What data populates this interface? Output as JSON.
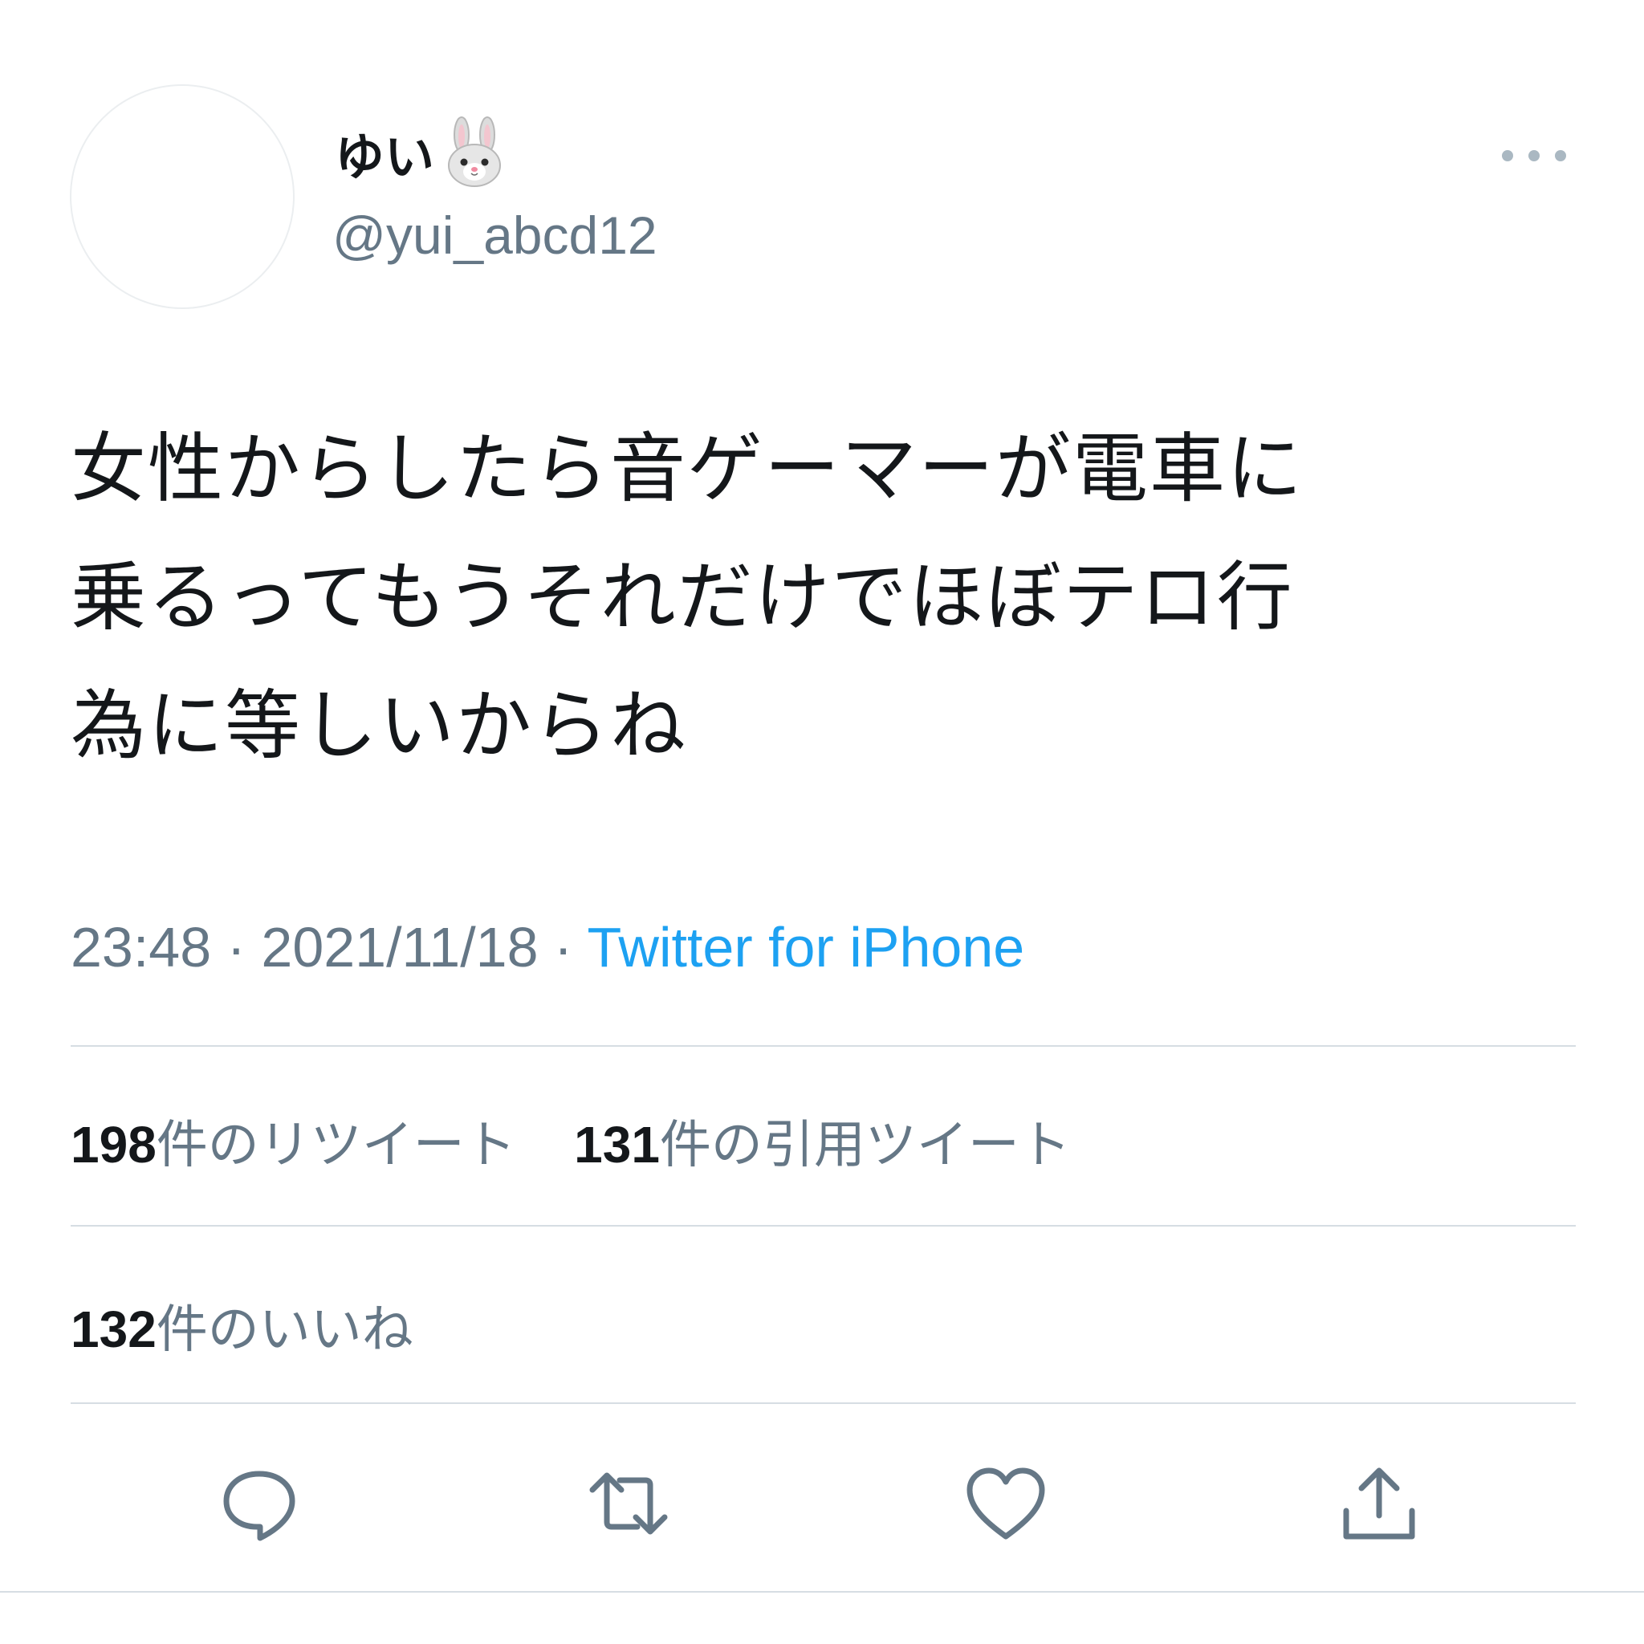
{
  "user": {
    "display_name": "ゆい",
    "emoji_icon": "rabbit-face-icon",
    "handle": "@yui_abcd12"
  },
  "tweet": {
    "lines": [
      "女性からしたら音ゲーマーが電車に",
      "乗るってもうそれだけでほぼテロ行",
      "為に等しいからね"
    ]
  },
  "meta": {
    "time": "23:48",
    "separator": "·",
    "date": "2021/11/18",
    "source": "Twitter for iPhone"
  },
  "stats": {
    "retweets": {
      "count": "198",
      "label": "件のリツイート"
    },
    "quotes": {
      "count": "131",
      "label": "件の引用ツイート"
    },
    "likes": {
      "count": "132",
      "label": "件のいいね"
    }
  },
  "actions": [
    "reply-icon",
    "retweet-icon",
    "like-icon",
    "share-icon"
  ],
  "colors": {
    "text": "#14171a",
    "muted": "#657786",
    "link": "#1da1f2",
    "divider": "#d6dde3"
  }
}
